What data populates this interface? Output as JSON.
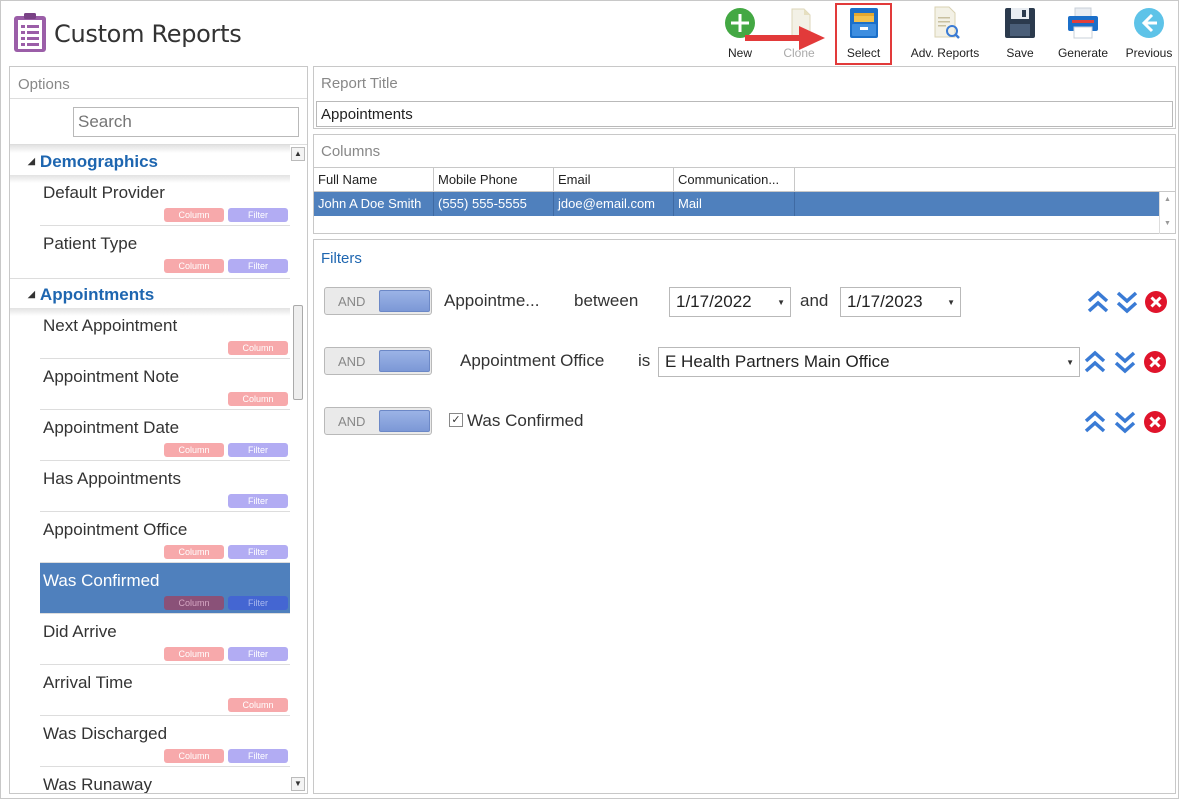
{
  "app": {
    "title": "Custom Reports"
  },
  "toolbar": {
    "new_label": "New",
    "clone_label": "Clone",
    "select_label": "Select",
    "adv_reports_label": "Adv. Reports",
    "save_label": "Save",
    "generate_label": "Generate",
    "previous_label": "Previous"
  },
  "options": {
    "title": "Options",
    "search_placeholder": "Search",
    "tag_column": "Column",
    "tag_filter": "Filter",
    "groups": [
      {
        "label": "Demographics",
        "items": [
          {
            "label": "Default Provider"
          },
          {
            "label": "Patient Type"
          }
        ]
      },
      {
        "label": "Appointments",
        "items": [
          {
            "label": "Next Appointment"
          },
          {
            "label": "Appointment Note"
          },
          {
            "label": "Appointment Date"
          },
          {
            "label": "Has Appointments"
          },
          {
            "label": "Appointment Office"
          },
          {
            "label": "Was Confirmed"
          },
          {
            "label": "Did Arrive"
          },
          {
            "label": "Arrival Time"
          },
          {
            "label": "Was Discharged"
          },
          {
            "label": "Was Runaway"
          }
        ]
      }
    ]
  },
  "report": {
    "title_label": "Report Title",
    "title_value": "Appointments",
    "columns_label": "Columns",
    "columns": [
      "Full Name",
      "Mobile Phone",
      "Email",
      "Communication..."
    ],
    "rows": [
      [
        "John A Doe Smith",
        "(555) 555-5555",
        "jdoe@email.com",
        "Mail"
      ]
    ]
  },
  "filters": {
    "title": "Filters",
    "and_label": "AND",
    "rows": [
      {
        "field": "Appointme...",
        "operator": "between",
        "from": "1/17/2022",
        "joiner": "and",
        "to": "1/17/2023"
      },
      {
        "field": "Appointment Office",
        "operator": "is",
        "value": "E Health Partners Main Office"
      },
      {
        "field": "Was Confirmed",
        "checked": "✓"
      }
    ]
  },
  "colors": {
    "accent_blue": "#1e66b0",
    "selected_row": "#4f80bd",
    "highlight_red": "#e23a3a"
  }
}
